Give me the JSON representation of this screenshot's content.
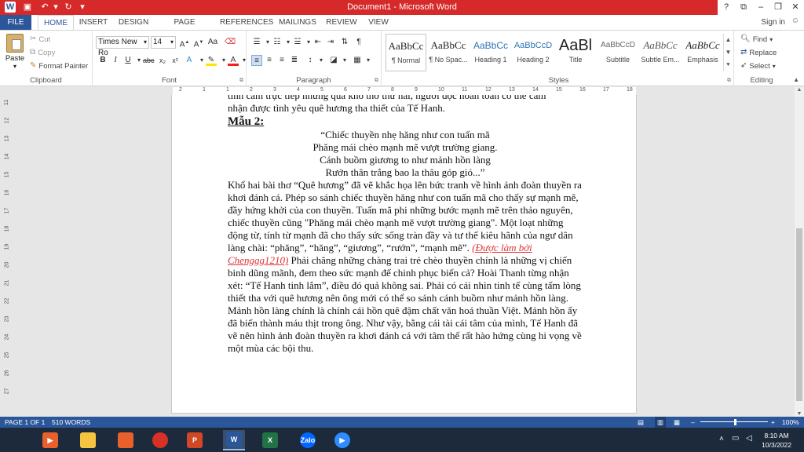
{
  "window": {
    "title": "Document1 - Microsoft Word",
    "controls": [
      "?",
      "⧉",
      "–",
      "❐",
      "✕"
    ]
  },
  "tabs": [
    {
      "label": "FILE"
    },
    {
      "label": "HOME"
    },
    {
      "label": "INSERT"
    },
    {
      "label": "DESIGN"
    },
    {
      "label": "PAGE LAYOUT"
    },
    {
      "label": "REFERENCES"
    },
    {
      "label": "MAILINGS"
    },
    {
      "label": "REVIEW"
    },
    {
      "label": "VIEW"
    }
  ],
  "signin": "Sign in",
  "ribbon": {
    "clipboard": {
      "label": "Clipboard",
      "paste": "Paste",
      "cut": "Cut",
      "copy": "Copy",
      "format_painter": "Format Painter"
    },
    "font": {
      "label": "Font",
      "name": "Times New Ro",
      "size": "14"
    },
    "paragraph": {
      "label": "Paragraph"
    },
    "styles": {
      "label": "Styles",
      "items": [
        {
          "preview": "AaBbCc",
          "name": "¶ Normal"
        },
        {
          "preview": "AaBbCc",
          "name": "¶ No Spac..."
        },
        {
          "preview": "AaBbCc",
          "name": "Heading 1"
        },
        {
          "preview": "AaBbCcD",
          "name": "Heading 2"
        },
        {
          "preview": "AaBl",
          "name": "Title"
        },
        {
          "preview": "AaBbCcD",
          "name": "Subtitle"
        },
        {
          "preview": "AaBbCc",
          "name": "Subtle Em..."
        },
        {
          "preview": "AaBbCc",
          "name": "Emphasis"
        }
      ]
    },
    "editing": {
      "label": "Editing",
      "find": "Find",
      "replace": "Replace",
      "select": "Select"
    }
  },
  "ruler": {
    "h_ticks": [
      "2",
      "1",
      "1",
      "2",
      "3",
      "4",
      "5",
      "6",
      "7",
      "8",
      "9",
      "10",
      "11",
      "12",
      "13",
      "14",
      "15",
      "16",
      "17",
      "18"
    ],
    "v_ticks": [
      "11",
      "12",
      "13",
      "14",
      "15",
      "16",
      "17",
      "18",
      "19",
      "20",
      "21",
      "22",
      "23",
      "24",
      "25",
      "26",
      "27"
    ]
  },
  "document": {
    "line0": "tình cảm trực tiếp nhưng qua khổ thơ thứ hai, người đọc hoàn toàn có thể cảm",
    "line1": "nhận được tình yêu quê hương tha thiết của Tế Hanh.",
    "heading": "Mẫu 2:",
    "poem": [
      "“Chiếc thuyền nhẹ hăng như con tuấn mã",
      "Phăng mái chèo mạnh mẽ vượt trường giang.",
      "Cánh buồm giương to như mảnh hồn làng",
      "Rướn thân trắng bao la thâu góp gió...”"
    ],
    "para_a": "Khổ hai bài thơ “Quê hương” đã vẽ khắc họa lên bức tranh về hình ảnh đoàn thuyền ra khơi đánh cá. Phép so sánh chiếc thuyền hăng như con tuấn mã cho thấy sự mạnh mẽ, đầy hứng khởi của con thuyền. Tuấn mã phi những bước mạnh mẽ trên thảo nguyên, chiếc thuyền cũng \"Phăng mái chèo mạnh mẽ vượt trường giang\". Một loạt những động từ, tính từ mạnh đã cho thấy sức sống tràn đầy và tư thế kiêu hãnh của ngư dân làng chài: “phăng”, “hăng”, “giương”, “rướn”, “mạnh mẽ”. ",
    "credit": "(Được làm bởi Chenggg1210)",
    "para_b": " Phải chăng những chàng trai trẻ chèo thuyền chính là những vị chiến binh dũng mãnh, đem theo sức mạnh để chinh phục biển cả? Hoài Thanh từng nhận xét: “Tế Hanh tinh lắm”, điều đó quả không sai. Phải có cái nhìn tinh tế cùng tấm lòng thiết tha với quê hương nên ông mới có thể so sánh cánh buồm như mảnh hồn làng. Mảnh hồn làng chính là chính cái hồn quê đậm chất văn hoá thuần Việt. Mảnh hồn ấy đã biến thành máu thịt trong ông. Như vậy, bằng cái tài cái tâm của mình, Tế Hanh đã vẽ nên hình ảnh đoàn thuyền ra khơi đánh cá với tâm thế rất hào hứng cùng hi vọng về một mùa các bội thu."
  },
  "status": {
    "page": "PAGE 1 OF 1",
    "words": "510 WORDS",
    "zoom": "100%",
    "zoom_level": 1.0
  },
  "taskbar": {
    "apps": [
      {
        "icon": "media-player-icon",
        "text": "▶",
        "color": "#e8602c"
      },
      {
        "icon": "file-explorer-icon",
        "text": "",
        "color": "#f5c542"
      },
      {
        "icon": "cortana-icon",
        "text": "",
        "color": "#e8602c"
      },
      {
        "icon": "chrome-icon",
        "text": "",
        "color": "#d93025"
      },
      {
        "icon": "powerpoint-icon",
        "text": "P",
        "color": "#d24726"
      },
      {
        "icon": "word-icon",
        "text": "W",
        "color": "#2b579a"
      },
      {
        "icon": "excel-icon",
        "text": "X",
        "color": "#217346"
      },
      {
        "icon": "zalo-icon",
        "text": "Zalo",
        "color": "#0068ff"
      },
      {
        "icon": "zoom-icon",
        "text": "▶",
        "color": "#2d8cff"
      }
    ],
    "time": "8:10 AM",
    "date": "10/3/2022"
  }
}
